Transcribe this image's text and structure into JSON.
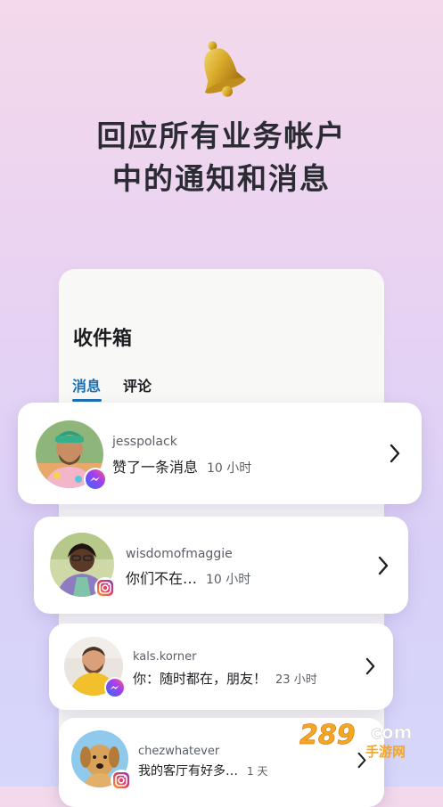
{
  "headline": {
    "line1": "回应所有业务帐户",
    "line2": "中的通知和消息"
  },
  "inbox": {
    "title": "收件箱",
    "tabs": [
      {
        "label": "消息",
        "active": true
      },
      {
        "label": "评论",
        "active": false
      }
    ],
    "conversations": [
      {
        "username": "jesspolack",
        "preview": "赞了一条消息",
        "time": "10 小时",
        "platform": "messenger-icon"
      },
      {
        "username": "wisdomofmaggie",
        "preview": "你们不在…",
        "time": "10 小时",
        "platform": "instagram-icon"
      },
      {
        "username": "kals.korner",
        "preview": "你：随时都在，朋友！",
        "time": "23 小时",
        "platform": "messenger-icon"
      },
      {
        "username": "chezwhatever",
        "preview": "我的客厅有好多…",
        "time": "1 天",
        "platform": "instagram-icon"
      }
    ]
  },
  "watermark": {
    "text1": "289",
    "text2": "com",
    "text3": "手游网"
  },
  "colors": {
    "accent": "#1b6fb3",
    "messenger": "#7b3ff2",
    "instagram": "#e4405f"
  }
}
